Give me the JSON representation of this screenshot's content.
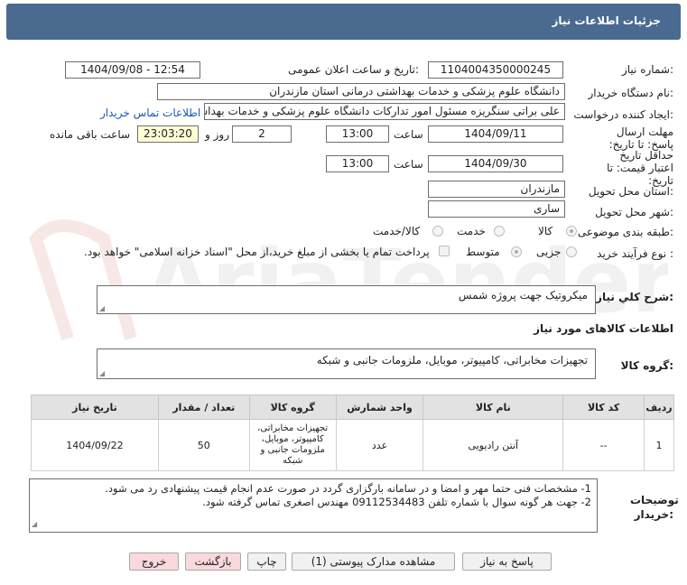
{
  "header": {
    "title": "جزئیات اطلاعات نیاز"
  },
  "labels": {
    "need_number": "شماره نیاز:",
    "announce_datetime": "تاریخ و ساعت اعلان عمومی:",
    "buyer_org": "نام دستگاه خریدار:",
    "requester": "ایجاد کننده درخواست:",
    "contact_link": "اطلاعات تماس خریدار",
    "reply_deadline": "مهلت ارسال پاسخ: تا تاریخ:",
    "time": "ساعت",
    "day_and": "روز و",
    "remaining": "ساعت باقی مانده",
    "validity": "حداقل تاریخ اعتبار قیمت: تا تاریخ:",
    "delivery_province": "استان محل تحویل:",
    "delivery_city": "شهر محل تحویل:",
    "category": "طبقه بندی موضوعی:",
    "purchase_type": "نوع فرآیند خرید :",
    "need_description": "شرح کلي نياز:",
    "goods_info": "اطلاعات کالاهای مورد نیاز",
    "goods_group": "گروه کالا:",
    "buyer_notes": "توضیحات خریدار:"
  },
  "values": {
    "need_number": "1104004350000245",
    "announce_datetime": "1404/09/08 - 12:54",
    "buyer_org": "دانشگاه علوم پزشکی و خدمات بهداشتی  درمانی استان مازندران",
    "requester": "علی براتی سنگریزه مسئول امور تدارکات دانشگاه علوم پزشکی و خدمات بهداشتی",
    "reply_date": "1404/09/11",
    "reply_time": "13:00",
    "reply_days": "2",
    "reply_remaining": "23:03:20",
    "validity_date": "1404/09/30",
    "validity_time": "13:00",
    "province": "مازندران",
    "city": "ساری",
    "need_description": "میکروتیک جهت پروژه شمس",
    "goods_group": "تجهیزات مخابراتی، کامپیوتر، موبایل، ملزومات جانبی و شبکه"
  },
  "category_options": [
    "کالا",
    "خدمت",
    "کالا/خدمت"
  ],
  "purchase_options": [
    "جزیی",
    "متوسط"
  ],
  "payment_note": "پرداخت تمام یا بخشی از مبلغ خرید،از محل \"اسناد خزانه اسلامی\" خواهد بود.",
  "table": {
    "headers": [
      "ردیف",
      "کد کالا",
      "نام کالا",
      "واحد شمارش",
      "گروه کالا",
      "تعداد / مقدار",
      "تاریخ نیاز"
    ],
    "rows": [
      {
        "row": "1",
        "code": "--",
        "name": "آنتن رادیویی",
        "unit": "عدد",
        "group": "تجهیزات مخابراتی، کامپیوتر، موبایل، ملزومات جانبی و شبکه",
        "qty": "50",
        "date": "1404/09/22"
      }
    ]
  },
  "notes": [
    "1- مشخصات فنی حتما مهر و امضا و در سامانه بارگزاری گردد در صورت عدم انجام قیمت پیشنهادی رد می شود.",
    "2- جهت هر گونه سوال با شماره تلفن 09112534483 مهندس اصغری تماس گرفته شود."
  ],
  "buttons": {
    "reply": "پاسخ به نیاز",
    "attachments": "مشاهده مدارک پیوستی (1)",
    "print": "چاپ",
    "back": "بازگشت",
    "exit": "خروج"
  },
  "watermark": "AriaTender.net"
}
